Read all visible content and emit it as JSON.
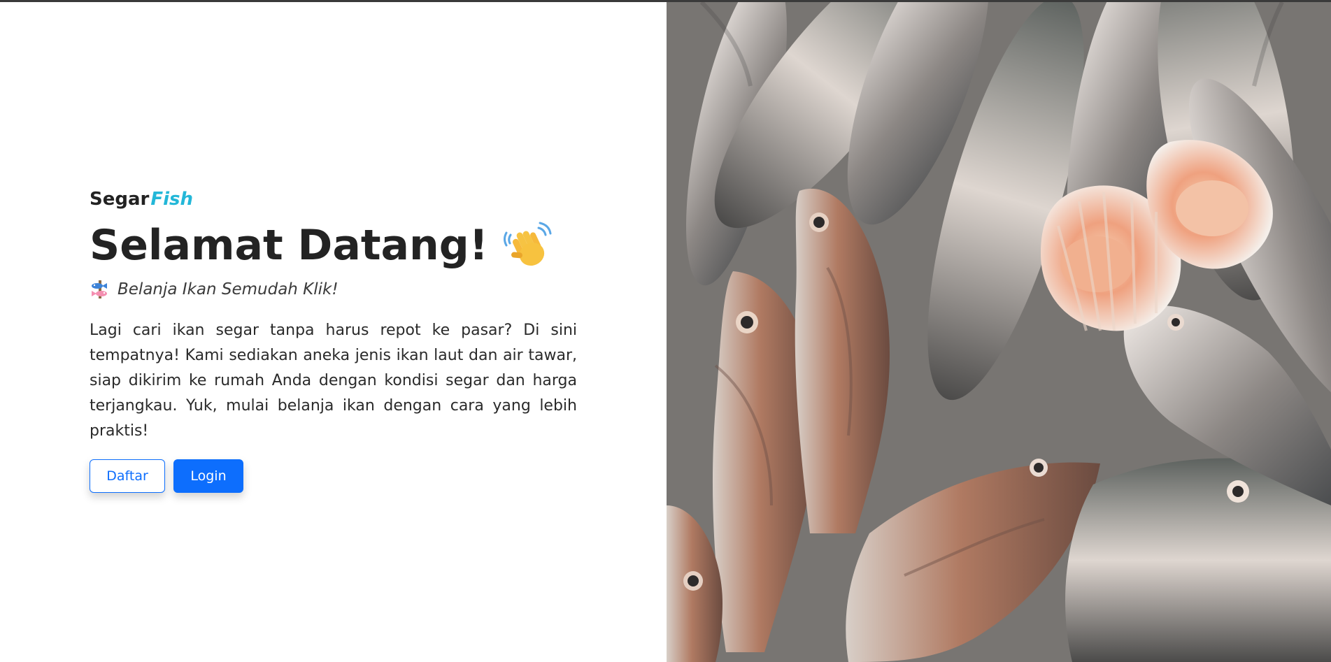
{
  "brand": {
    "name_main": "Segar",
    "name_accent": "Fish",
    "accent_color": "#23b7d8"
  },
  "hero": {
    "title": "Selamat Datang!",
    "title_icon": "waving-hand-icon",
    "tagline_icon": "fish-icon",
    "tagline": "Belanja Ikan Semudah Klik!",
    "description": "Lagi cari ikan segar tanpa harus repot ke pasar? Di sini tempatnya! Kami sediakan aneka jenis ikan laut dan air tawar, siap dikirim ke rumah Anda dengan kondisi segar dan harga terjangkau. Yuk, mulai belanja ikan dengan cara yang lebih praktis!"
  },
  "buttons": {
    "register_label": "Daftar",
    "login_label": "Login",
    "primary_color": "#0d6efd"
  },
  "image": {
    "subject": "fresh-fish-and-scallops-photo"
  }
}
